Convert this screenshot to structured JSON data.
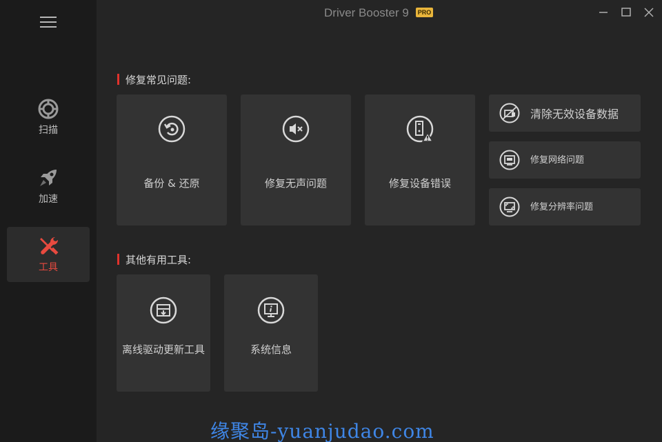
{
  "window": {
    "title": "Driver Booster 9",
    "badge": "PRO"
  },
  "sidebar": {
    "items": [
      {
        "label": "扫描",
        "icon": "scan-icon",
        "active": false
      },
      {
        "label": "加速",
        "icon": "rocket-icon",
        "active": false
      },
      {
        "label": "工具",
        "icon": "tools-icon",
        "active": true
      }
    ]
  },
  "sections": {
    "common": {
      "title": "修复常见问题:",
      "cards": [
        {
          "label": "备份 & 还原",
          "icon": "backup-restore-icon"
        },
        {
          "label": "修复无声问题",
          "icon": "speaker-mute-icon"
        },
        {
          "label": "修复设备错误",
          "icon": "device-warning-icon"
        }
      ],
      "small_cards": [
        {
          "label": "清除无效设备数据",
          "icon": "clean-device-icon"
        },
        {
          "label": "修复网络问题",
          "icon": "network-port-icon"
        },
        {
          "label": "修复分辨率问题",
          "icon": "resolution-icon"
        }
      ]
    },
    "other": {
      "title": "其他有用工具:",
      "cards": [
        {
          "label": "离线驱动更新工具",
          "icon": "offline-download-icon"
        },
        {
          "label": "系统信息",
          "icon": "system-info-icon"
        }
      ]
    }
  },
  "watermark": "缘聚岛-yuanjudao.com",
  "colors": {
    "accent": "#e84a3f",
    "sidebar_bg": "#1b1b1b",
    "content_bg": "#252525",
    "card_bg": "#333333",
    "pro_badge": "#e9b53b",
    "watermark": "#3f86e6"
  }
}
